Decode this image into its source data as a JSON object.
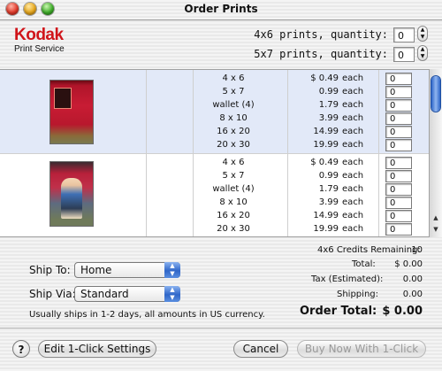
{
  "window": {
    "title": "Order Prints"
  },
  "logo": {
    "brand": "Kodak",
    "service": "Print Service"
  },
  "header_quantities": [
    {
      "label": "4x6 prints, quantity:",
      "value": "0"
    },
    {
      "label": "5x7 prints, quantity:",
      "value": "0"
    }
  ],
  "photos": [
    {
      "rows": [
        {
          "size": "4 x 6",
          "price": "$ 0.49",
          "unit": "each",
          "qty": "0"
        },
        {
          "size": "5 x 7",
          "price": "0.99",
          "unit": "each",
          "qty": "0"
        },
        {
          "size": "wallet (4)",
          "price": "1.79",
          "unit": "each",
          "qty": "0"
        },
        {
          "size": "8 x 10",
          "price": "3.99",
          "unit": "each",
          "qty": "0"
        },
        {
          "size": "16 x 20",
          "price": "14.99",
          "unit": "each",
          "qty": "0"
        },
        {
          "size": "20 x 30",
          "price": "19.99",
          "unit": "each",
          "qty": "0"
        }
      ]
    },
    {
      "rows": [
        {
          "size": "4 x 6",
          "price": "$ 0.49",
          "unit": "each",
          "qty": "0"
        },
        {
          "size": "5 x 7",
          "price": "0.99",
          "unit": "each",
          "qty": "0"
        },
        {
          "size": "wallet (4)",
          "price": "1.79",
          "unit": "each",
          "qty": "0"
        },
        {
          "size": "8 x 10",
          "price": "3.99",
          "unit": "each",
          "qty": "0"
        },
        {
          "size": "16 x 20",
          "price": "14.99",
          "unit": "each",
          "qty": "0"
        },
        {
          "size": "20 x 30",
          "price": "19.99",
          "unit": "each",
          "qty": "0"
        }
      ]
    }
  ],
  "shipping": {
    "ship_to_label": "Ship To:",
    "ship_to_value": "Home",
    "ship_via_label": "Ship Via:",
    "ship_via_value": "Standard",
    "note": "Usually ships in 1-2 days, all amounts in US currency."
  },
  "summary": {
    "credits_label": "4x6 Credits Remaining:",
    "credits_value": "10",
    "total_label": "Total:",
    "total_value": "$ 0.00",
    "tax_label": "Tax (Estimated):",
    "tax_value": "0.00",
    "shipping_label": "Shipping:",
    "shipping_value": "0.00",
    "order_total_label": "Order Total:",
    "order_total_value": "$ 0.00"
  },
  "buttons": {
    "help": "?",
    "edit_settings": "Edit 1-Click Settings",
    "cancel": "Cancel",
    "buy_now": "Buy Now With 1-Click"
  }
}
